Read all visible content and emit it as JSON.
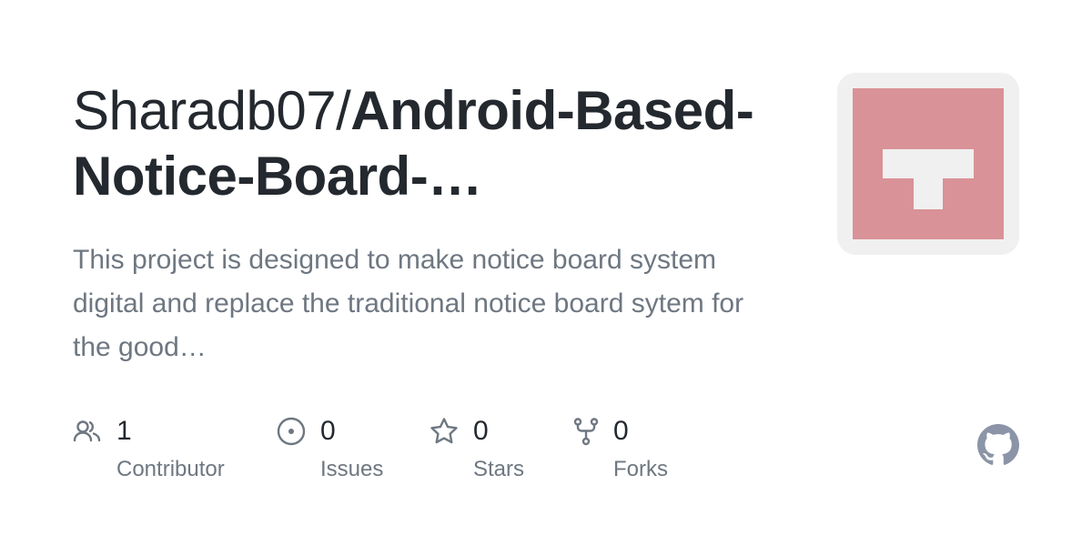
{
  "owner": "Sharadb07/",
  "repo_name": "Android-Based-Notice-Board-…",
  "description": "This project is designed to make notice board system digital and replace the traditional notice board sytem for the good…",
  "stats": [
    {
      "icon": "people-icon",
      "value": "1",
      "label": "Contributor"
    },
    {
      "icon": "issue-icon",
      "value": "0",
      "label": "Issues"
    },
    {
      "icon": "star-icon",
      "value": "0",
      "label": "Stars"
    },
    {
      "icon": "fork-icon",
      "value": "0",
      "label": "Forks"
    }
  ],
  "colors": {
    "identicon": "#d99297",
    "identicon_bg": "#f0f0f0",
    "text": "#24292f",
    "muted": "#6e7781",
    "logo": "#8b95a7"
  }
}
